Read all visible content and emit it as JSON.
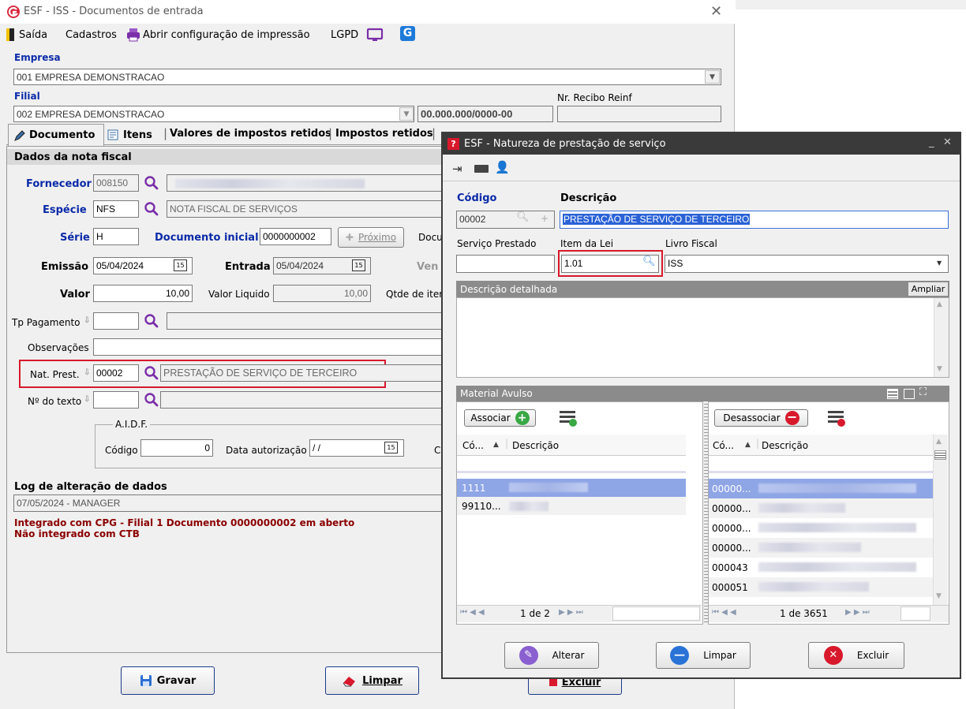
{
  "main": {
    "title": "ESF - ISS - Documentos de entrada",
    "menu": {
      "saida": "Saída",
      "cadastros": "Cadastros",
      "print_config": "Abrir configuração de impressão",
      "lgpd": "LGPD"
    },
    "empresa_label": "Empresa",
    "empresa_value": "001 EMPRESA DEMONSTRACAO",
    "filial_label": "Filial",
    "filial_value": "002 EMPRESA DEMONSTRACAO",
    "cnpj": "00.000.000/0000-00",
    "recibo_label": "Nr. Recibo Reinf",
    "tabs": [
      "Documento",
      "Itens",
      "Valores de impostos retidos",
      "Impostos retidos"
    ],
    "section_title": "Dados da nota fiscal",
    "fields": {
      "fornecedor_label": "Fornecedor",
      "fornecedor_code": "008150",
      "especie_label": "Espécie",
      "especie_code": "NFS",
      "especie_desc": "NOTA FISCAL DE SERVIÇOS",
      "serie_label": "Série",
      "serie_value": "H",
      "doc_inicial_label": "Documento inicial",
      "doc_inicial_value": "0000000002",
      "proximo_label": "Próximo",
      "docu_trunc": "Docu",
      "emissao_label": "Emissão",
      "emissao_value": "05/04/2024",
      "entrada_label": "Entrada",
      "entrada_value": "05/04/2024",
      "vend_trunc": "Ven",
      "valor_label": "Valor",
      "valor_value": "10,00",
      "valor_liquido_label": "Valor Liquido",
      "valor_liquido_value": "10,00",
      "qtde_trunc": "Qtde de iter",
      "tp_pagamento_label": "Tp Pagamento",
      "observacoes_label": "Observações",
      "nat_prest_label": "Nat. Prest.",
      "nat_prest_code": "00002",
      "nat_prest_desc": "PRESTAÇÃO DE SERVIÇO DE TERCEIRO",
      "num_texto_label": "Nº do texto"
    },
    "aidf": {
      "title": "A.I.D.F.",
      "codigo_label": "Código",
      "codigo_value": "0",
      "data_label": "Data autorização",
      "data_value": " / /",
      "trunc": "C"
    },
    "log": {
      "title": "Log de alteração de dados",
      "value": "07/05/2024 - MANAGER",
      "msg1": "Integrado com CPG - Filial 1 Documento 0000000002 em aberto",
      "msg2": "Não integrado com CTB"
    },
    "buttons": {
      "gravar": "Gravar",
      "limpar": "Limpar",
      "excluir": "Excluir"
    }
  },
  "dialog": {
    "title": "ESF - Natureza de prestação de serviço",
    "codigo_label": "Código",
    "codigo_value": "00002",
    "descricao_label": "Descrição",
    "descricao_value": "PRESTAÇÃO DE SERVIÇO DE TERCEIRO",
    "servico_label": "Serviço Prestado",
    "item_lei_label": "Item da Lei",
    "item_lei_value": "1.01",
    "livro_label": "Livro Fiscal",
    "livro_value": "ISS",
    "desc_detalhada_label": "Descrição detalhada",
    "ampliar_label": "Ampliar",
    "material_label": "Material Avulso",
    "associar_label": "Associar",
    "desassociar_label": "Desassociar",
    "left_grid": {
      "headers": [
        "Có...",
        "Descrição"
      ],
      "rows": [
        "1111",
        "99110..."
      ],
      "pager": "1 de 2"
    },
    "right_grid": {
      "headers": [
        "Có...",
        "Descrição"
      ],
      "rows": [
        "00000...",
        "00000...",
        "00000...",
        "00000...",
        "000043",
        "000051"
      ],
      "pager": "1 de 3651"
    },
    "buttons": {
      "alterar": "Alterar",
      "limpar": "Limpar",
      "excluir": "Excluir"
    }
  }
}
